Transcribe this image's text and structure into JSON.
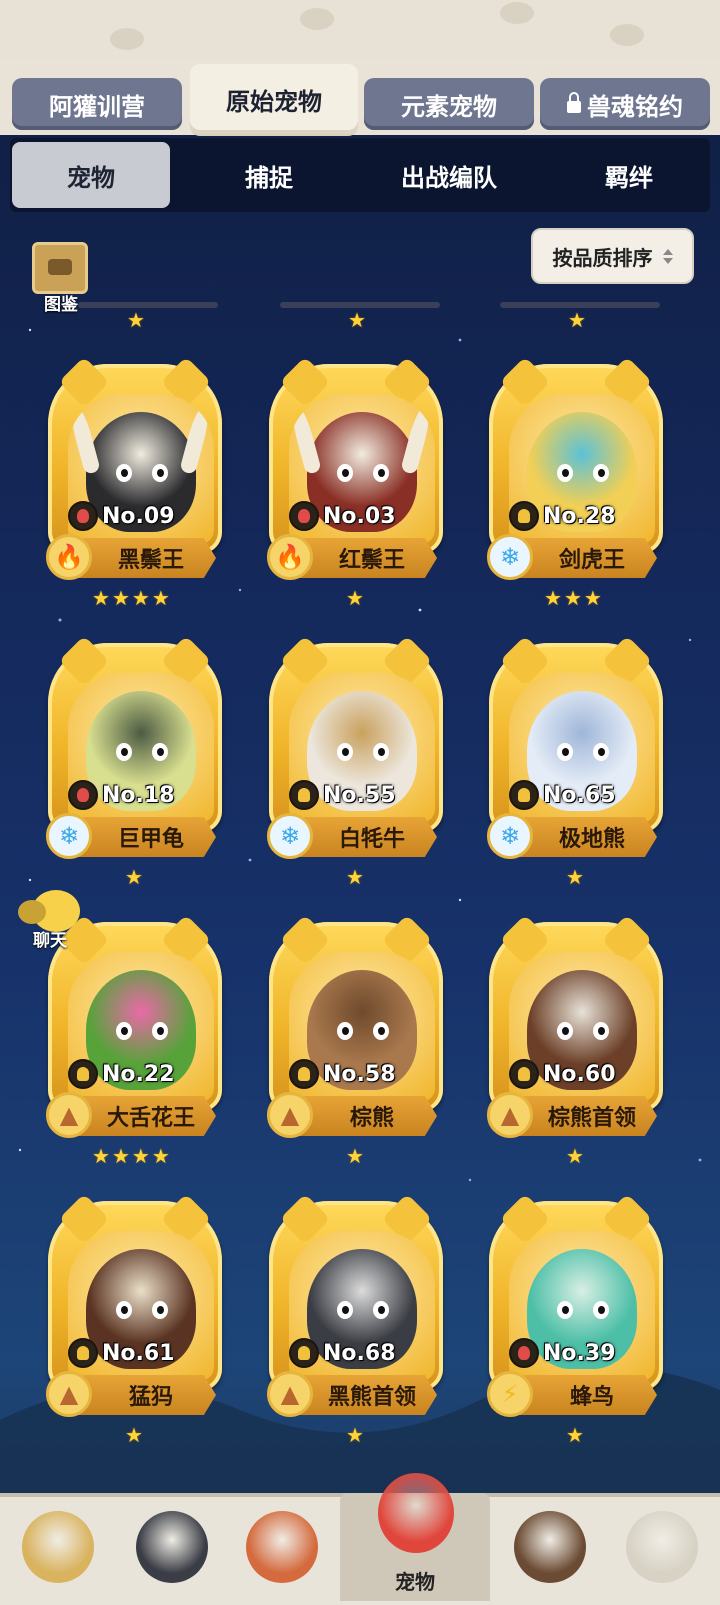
{
  "top_tabs": [
    {
      "label": "阿獾训营",
      "locked": false
    },
    {
      "label": "原始宠物",
      "locked": false,
      "active": true
    },
    {
      "label": "元素宠物",
      "locked": false
    },
    {
      "label": "兽魂铭约",
      "locked": true
    }
  ],
  "sub_tabs": [
    {
      "label": "宠物",
      "active": true
    },
    {
      "label": "捕捉"
    },
    {
      "label": "出战编队"
    },
    {
      "label": "羁绊"
    }
  ],
  "codex": {
    "label": "图鉴"
  },
  "sort": {
    "label": "按品质排序"
  },
  "chat": {
    "label": "聊天"
  },
  "top_stars": [
    1,
    1,
    1
  ],
  "pets": [
    {
      "no": "No.09",
      "name": "黑鬃王",
      "element": "fire",
      "stars": 4,
      "type": "meat",
      "body": "#2b2b2e",
      "accent": "#f1ece0"
    },
    {
      "no": "No.03",
      "name": "红鬃王",
      "element": "fire",
      "stars": 1,
      "type": "meat",
      "body": "#8a2f25",
      "accent": "#f1ece0"
    },
    {
      "no": "No.28",
      "name": "剑虎王",
      "element": "ice",
      "stars": 3,
      "type": "person",
      "body": "#f2cf55",
      "accent": "#5bc2d6"
    },
    {
      "no": "No.18",
      "name": "巨甲龟",
      "element": "ice",
      "stars": 1,
      "type": "meat",
      "body": "#d8df8f",
      "accent": "#4d5b44"
    },
    {
      "no": "No.55",
      "name": "白牦牛",
      "element": "ice",
      "stars": 1,
      "type": "person",
      "body": "#ece6dc",
      "accent": "#c9a15d"
    },
    {
      "no": "No.65",
      "name": "极地熊",
      "element": "ice",
      "stars": 1,
      "type": "person",
      "body": "#e4ecf7",
      "accent": "#9fb6d8"
    },
    {
      "no": "No.22",
      "name": "大舌花王",
      "element": "earth",
      "stars": 4,
      "type": "person",
      "body": "#58a23a",
      "accent": "#e96aa8"
    },
    {
      "no": "No.58",
      "name": "棕熊",
      "element": "earth",
      "stars": 1,
      "type": "person",
      "body": "#a9784d",
      "accent": "#6e4a2c"
    },
    {
      "no": "No.60",
      "name": "棕熊首领",
      "element": "earth",
      "stars": 1,
      "type": "person",
      "body": "#6c4028",
      "accent": "#e8e2d8"
    },
    {
      "no": "No.61",
      "name": "猛犸",
      "element": "earth",
      "stars": 1,
      "type": "person",
      "body": "#5a3322",
      "accent": "#eadfc8"
    },
    {
      "no": "No.68",
      "name": "黑熊首领",
      "element": "earth",
      "stars": 1,
      "type": "person",
      "body": "#3b3d44",
      "accent": "#dcdcdc"
    },
    {
      "no": "No.39",
      "name": "蜂鸟",
      "element": "bolt",
      "stars": 1,
      "type": "meat",
      "body": "#4dbfa7",
      "accent": "#d8efe4"
    }
  ],
  "bottom_nav": [
    {
      "label": "",
      "avatar": "#d9b35e"
    },
    {
      "label": "",
      "avatar": "#3a3d45"
    },
    {
      "label": "",
      "avatar": "#d46a3d"
    },
    {
      "label": "宠物",
      "avatar": "#e1463c",
      "active": true
    },
    {
      "label": "",
      "avatar": "#6b4b33"
    },
    {
      "label": "",
      "avatar": "#d7d2c3"
    }
  ],
  "colors": {
    "star": "#ffd33a",
    "frame_gold": "#f0b52a",
    "bg_top": "#0f1d3f",
    "bg_bottom": "#1d4578"
  }
}
